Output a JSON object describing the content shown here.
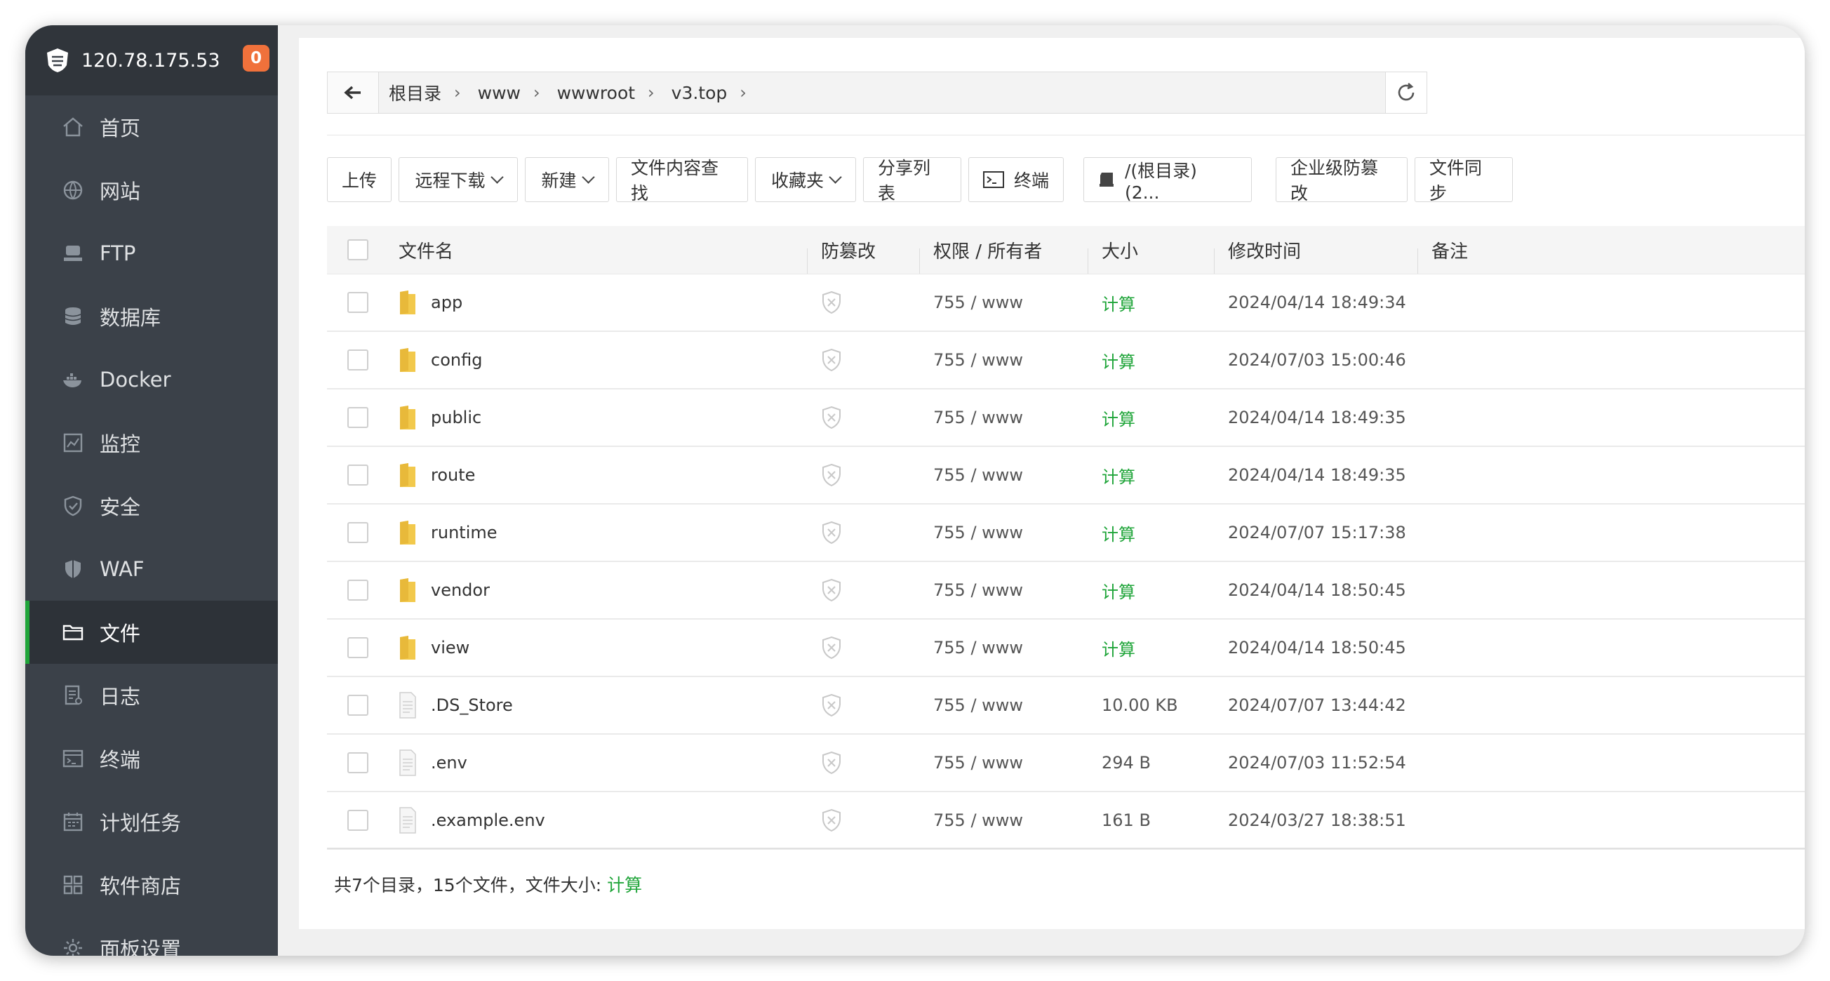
{
  "server": {
    "ip": "120.78.175.53",
    "notifications": "0"
  },
  "nav": [
    {
      "label": "首页",
      "icon": "home-icon",
      "active": false
    },
    {
      "label": "网站",
      "icon": "globe-icon",
      "active": false
    },
    {
      "label": "FTP",
      "icon": "ftp-icon",
      "active": false
    },
    {
      "label": "数据库",
      "icon": "database-icon",
      "active": false
    },
    {
      "label": "Docker",
      "icon": "docker-icon",
      "active": false
    },
    {
      "label": "监控",
      "icon": "monitor-icon",
      "active": false
    },
    {
      "label": "安全",
      "icon": "shield-check-icon",
      "active": false
    },
    {
      "label": "WAF",
      "icon": "waf-shield-icon",
      "active": false
    },
    {
      "label": "文件",
      "icon": "folder-icon",
      "active": true
    },
    {
      "label": "日志",
      "icon": "log-icon",
      "active": false
    },
    {
      "label": "终端",
      "icon": "terminal-icon",
      "active": false
    },
    {
      "label": "计划任务",
      "icon": "calendar-icon",
      "active": false
    },
    {
      "label": "软件商店",
      "icon": "apps-grid-icon",
      "active": false
    },
    {
      "label": "面板设置",
      "icon": "gear-icon",
      "active": false
    }
  ],
  "breadcrumb": [
    "根目录",
    "www",
    "wwwroot",
    "v3.top"
  ],
  "toolbar": {
    "upload": "上传",
    "remote_download": "远程下载",
    "new": "新建",
    "content_search": "文件内容查找",
    "favorites": "收藏夹",
    "share_list": "分享列表",
    "terminal": "终端",
    "disk": "/(根目录) (2...",
    "tamper_protect": "企业级防篡改",
    "file_sync": "文件同步"
  },
  "columns": {
    "name": "文件名",
    "tamper": "防篡改",
    "perm": "权限 / 所有者",
    "size": "大小",
    "mtime": "修改时间",
    "note": "备注"
  },
  "files": [
    {
      "name": "app",
      "type": "folder",
      "perm": "755 / www",
      "size": "计算",
      "mtime": "2024/04/14 18:49:34"
    },
    {
      "name": "config",
      "type": "folder",
      "perm": "755 / www",
      "size": "计算",
      "mtime": "2024/07/03 15:00:46"
    },
    {
      "name": "public",
      "type": "folder",
      "perm": "755 / www",
      "size": "计算",
      "mtime": "2024/04/14 18:49:35"
    },
    {
      "name": "route",
      "type": "folder",
      "perm": "755 / www",
      "size": "计算",
      "mtime": "2024/04/14 18:49:35"
    },
    {
      "name": "runtime",
      "type": "folder",
      "perm": "755 / www",
      "size": "计算",
      "mtime": "2024/07/07 15:17:38"
    },
    {
      "name": "vendor",
      "type": "folder",
      "perm": "755 / www",
      "size": "计算",
      "mtime": "2024/04/14 18:50:45"
    },
    {
      "name": "view",
      "type": "folder",
      "perm": "755 / www",
      "size": "计算",
      "mtime": "2024/04/14 18:50:45"
    },
    {
      "name": ".DS_Store",
      "type": "file",
      "perm": "755 / www",
      "size": "10.00 KB",
      "mtime": "2024/07/07 13:44:42"
    },
    {
      "name": ".env",
      "type": "file",
      "perm": "755 / www",
      "size": "294 B",
      "mtime": "2024/07/03 11:52:54"
    },
    {
      "name": ".example.env",
      "type": "file",
      "perm": "755 / www",
      "size": "161 B",
      "mtime": "2024/03/27 18:38:51"
    }
  ],
  "summary": {
    "text": "共7个目录，15个文件，文件大小:",
    "calc": "计算"
  },
  "colors": {
    "accent": "#20a53a",
    "sidebar": "#3b4149",
    "badge": "#f0713b"
  }
}
